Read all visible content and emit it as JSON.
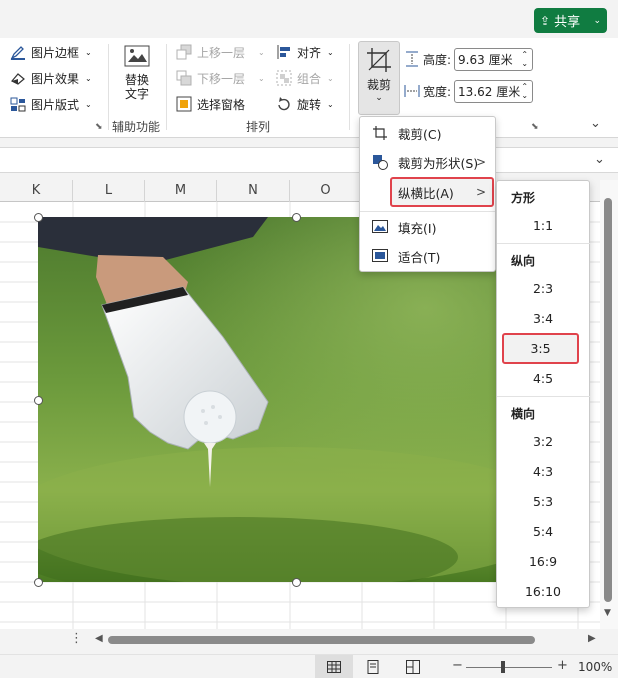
{
  "share": {
    "label": "共享"
  },
  "ribbon": {
    "picture_styles": {
      "border": "图片边框",
      "effects": "图片效果",
      "layout": "图片版式"
    },
    "alt_text": {
      "line1": "替换",
      "line2": "文字",
      "group_label": "辅助功能"
    },
    "arrange": {
      "bring_forward": "上移一层",
      "send_backward": "下移一层",
      "selection_pane": "选择窗格",
      "align": "对齐",
      "group": "组合",
      "rotate": "旋转",
      "group_label": "排列"
    },
    "crop": {
      "label": "裁剪"
    },
    "size": {
      "height_label": "高度:",
      "height_value": "9.63 厘米",
      "width_label": "宽度:",
      "width_value": "13.62 厘米"
    }
  },
  "columns": [
    "K",
    "L",
    "M",
    "N",
    "O"
  ],
  "crop_menu": {
    "items": [
      {
        "label": "裁剪(C)",
        "icon": "crop-icon"
      },
      {
        "label": "裁剪为形状(S)",
        "icon": "crop-to-shape-icon",
        "has_submenu": true
      },
      {
        "label": "纵横比(A)",
        "icon": "",
        "has_submenu": true,
        "highlighted": true
      },
      {
        "label": "填充(I)",
        "icon": "fill-icon"
      },
      {
        "label": "适合(T)",
        "icon": "fit-icon"
      }
    ]
  },
  "aspect_menu": {
    "square_header": "方形",
    "square_items": [
      "1:1"
    ],
    "portrait_header": "纵向",
    "portrait_items": [
      "2:3",
      "3:4",
      "3:5",
      "4:5"
    ],
    "landscape_header": "横向",
    "landscape_items": [
      "3:2",
      "4:3",
      "5:3",
      "5:4",
      "16:9",
      "16:10"
    ],
    "selected": "3:5"
  },
  "status": {
    "zoom": "100%"
  },
  "colors": {
    "accent_green": "#107c41",
    "highlight_red": "#e0434c"
  }
}
